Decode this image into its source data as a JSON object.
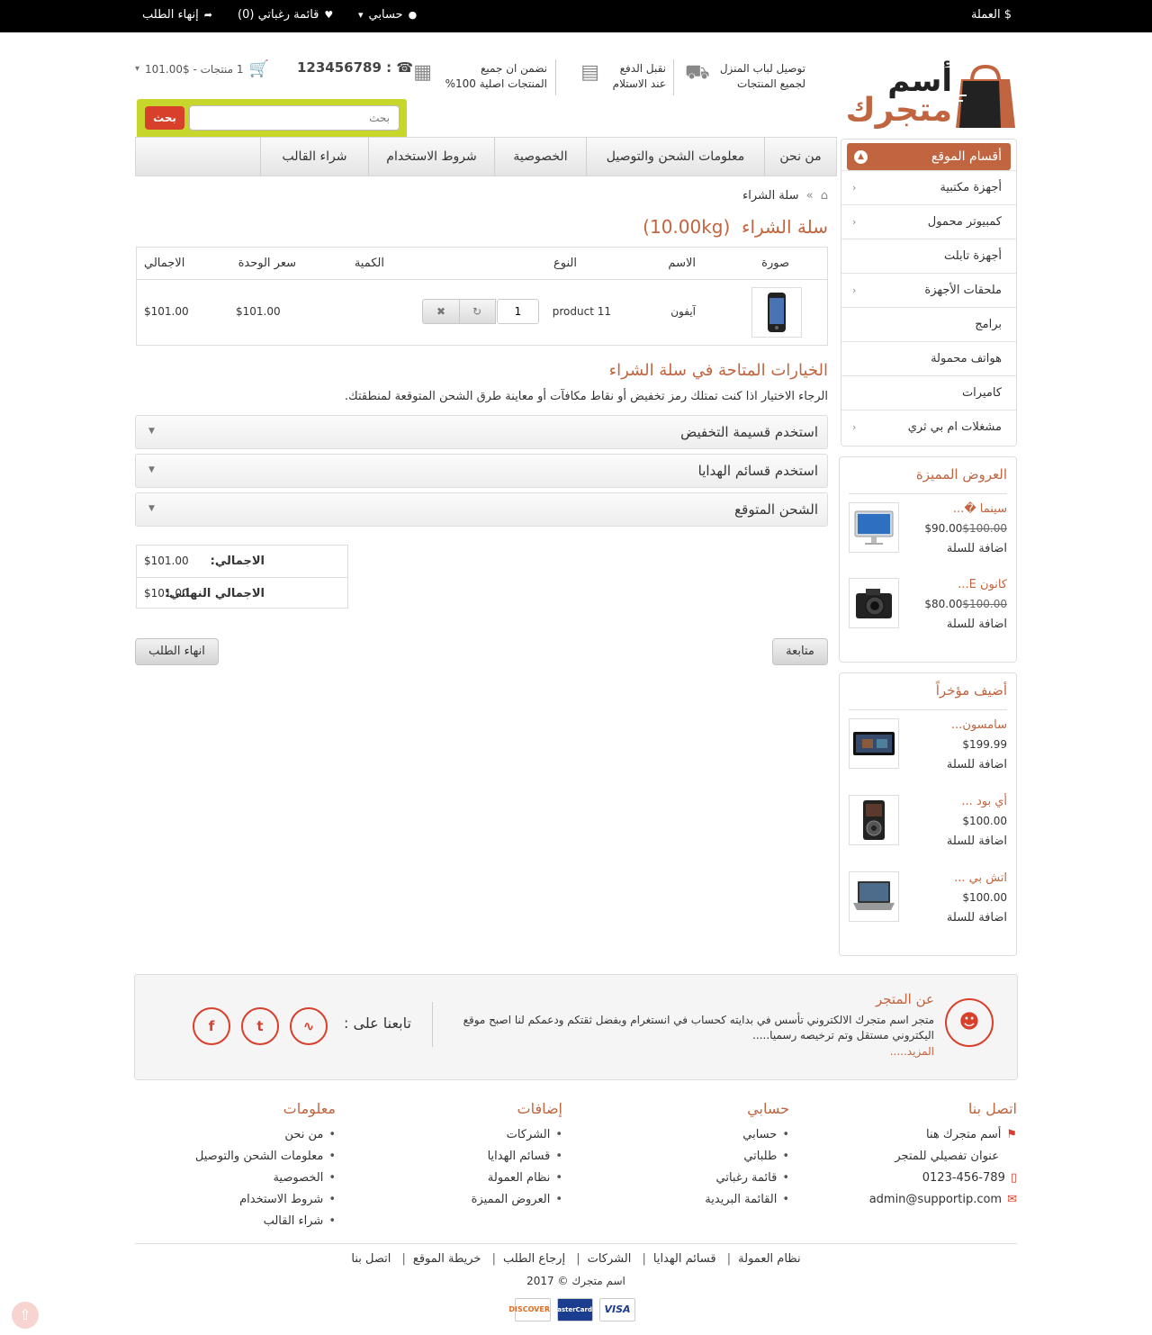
{
  "topbar": {
    "currency": "$ العملة",
    "account": "حسابي",
    "wishlist": "قائمة رغباتي (0)",
    "checkout": "إنهاء الطلب"
  },
  "header": {
    "logo_line1": "أسم",
    "logo_line2": "متجرك",
    "features": [
      {
        "line1": "توصيل لباب المنزل",
        "line2": "لجميع المنتجات",
        "icon": "truck-icon"
      },
      {
        "line1": "نقبل الدفع",
        "line2": "عند الاستلام",
        "icon": "cash-icon"
      },
      {
        "line1": "نضمن ان جميع",
        "line2": "المنتجات اصلية 100%",
        "icon": "gift-icon"
      }
    ],
    "phone": "123456789",
    "cart_summary": "1 منتجات - $101.00"
  },
  "search": {
    "placeholder": "بحث",
    "button": "بحث"
  },
  "nav": [
    "من نحن",
    "معلومات الشحن والتوصيل",
    "الخصوصية",
    "شروط الاستخدام",
    "شراء القالب"
  ],
  "sidebar": {
    "title": "أقسام الموقع",
    "categories": [
      {
        "label": "أجهزة مكتبية",
        "sub": true
      },
      {
        "label": "كمبيوتر محمول",
        "sub": true
      },
      {
        "label": "أجهزة تابلت",
        "sub": false
      },
      {
        "label": "ملحقات الأجهزة",
        "sub": true
      },
      {
        "label": "برامج",
        "sub": false
      },
      {
        "label": "هواتف محمولة",
        "sub": false
      },
      {
        "label": "كاميرات",
        "sub": false
      },
      {
        "label": "مشغلات ام بي ثري",
        "sub": true
      }
    ],
    "featured": {
      "title": "العروض المميزة",
      "items": [
        {
          "name": "سينما �...",
          "price": "$90.00",
          "old_price": "$100.00",
          "add": "اضافة للسلة"
        },
        {
          "name": "كانون E...",
          "price": "$80.00",
          "old_price": "$100.00",
          "add": "اضافة للسلة"
        }
      ]
    },
    "latest": {
      "title": "أضيف مؤخراً",
      "items": [
        {
          "name": "سامسون...",
          "price": "$199.99",
          "add": "اضافة للسلة"
        },
        {
          "name": "أي بود ...",
          "price": "$100.00",
          "add": "اضافة للسلة"
        },
        {
          "name": "اتش بي ...",
          "price": "$100.00",
          "add": "اضافة للسلة"
        }
      ]
    }
  },
  "main": {
    "breadcrumb": "سلة الشراء",
    "title": "سلة الشراء",
    "weight": "(10.00kg)",
    "table": {
      "headers": {
        "image": "صورة",
        "name": "الاسم",
        "model": "النوع",
        "qty": "الكمية",
        "unit": "سعر الوحدة",
        "total": "الاجمالي"
      },
      "row": {
        "name": "آيفون",
        "model": "product 11",
        "qty": "1",
        "unit": "$101.00",
        "total": "$101.00"
      }
    },
    "options_title": "الخيارات المتاحة في سلة الشراء",
    "options_text": "الرجاء الاختيار اذا كنت تمتلك رمز تخفيض أو نقاط مكافآت أو معاينة طرق الشحن المتوقعة لمنطقتك.",
    "accordions": [
      "استخدم قسيمة التخفيض",
      "استخدم قسائم الهدايا",
      "الشحن المتوقع"
    ],
    "totals": [
      {
        "label": "الاجمالي:",
        "value": "$101.00"
      },
      {
        "label": "الاجمالي النهائي:",
        "value": "$101.00"
      }
    ],
    "continue": "متابعة",
    "checkout": "انهاء الطلب"
  },
  "footer": {
    "about_title": "عن المتجر",
    "about_text": "متجر اسم متجرك الالكتروني تأسس في بدايته كحساب في انستغرام وبفضل ثقتكم ودعمكم لنا اصبح موقع اليكتروني مستقل وتم ترخيصه رسميا.....",
    "about_more": "المزيد.....",
    "follow": "تابعنا على :",
    "contact": {
      "title": "اتصل بنا",
      "items": [
        "أسم متجرك هنا",
        "عنوان تفصيلي للمتجر",
        "0123-456-789",
        "admin@supportip.com"
      ]
    },
    "account": {
      "title": "حسابي",
      "items": [
        "حسابي",
        "طلباتي",
        "قائمة رغباتي",
        "القائمة البريدية"
      ]
    },
    "extras": {
      "title": "إضافات",
      "items": [
        "الشركات",
        "قسائم الهدايا",
        "نظام العمولة",
        "العروض المميزة"
      ]
    },
    "info": {
      "title": "معلومات",
      "items": [
        "من نحن",
        "معلومات الشحن والتوصيل",
        "الخصوصية",
        "شروط الاستخدام",
        "شراء القالب"
      ]
    },
    "bottom_links": [
      "نظام العمولة",
      "قسائم الهدايا",
      "الشركات",
      "إرجاع الطلب",
      "خريطة الموقع",
      "اتصل بنا"
    ],
    "copyright": "اسم متجرك © 2017",
    "cards": [
      "DISCOVER",
      "MasterCard",
      "VISA"
    ]
  },
  "colors": {
    "brand": "#c0653f",
    "accent_green": "#c7d62a",
    "button_red": "#d9402b"
  }
}
